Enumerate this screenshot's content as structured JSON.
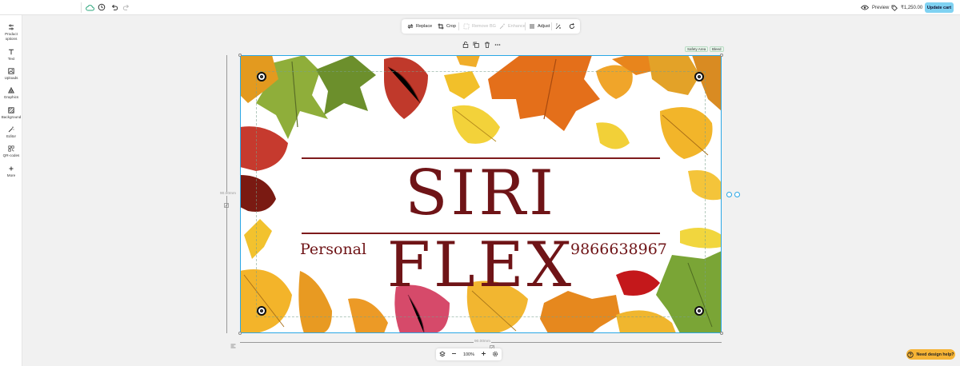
{
  "topbar": {
    "preview_label": "Preview",
    "price": "₹1,250.00",
    "update_label": "Update cart"
  },
  "sidebar": {
    "items": [
      {
        "label": "Product options",
        "icon": "sliders-icon"
      },
      {
        "label": "Text",
        "icon": "text-icon"
      },
      {
        "label": "Uploads",
        "icon": "upload-icon"
      },
      {
        "label": "Graphics",
        "icon": "shapes-icon"
      },
      {
        "label": "Background",
        "icon": "background-icon"
      },
      {
        "label": "Editor",
        "icon": "magic-wand-icon"
      },
      {
        "label": "QR-codes",
        "icon": "qr-code-icon"
      },
      {
        "label": "More",
        "icon": "plus-icon"
      }
    ]
  },
  "toolbar": {
    "replace": "Replace",
    "crop": "Crop",
    "remove_bg": "Remove BG",
    "enhance": "Enhance",
    "adjust": "Adjust"
  },
  "badges": {
    "safety": "Safety Area",
    "bleed": "Bleed"
  },
  "card": {
    "title": "SIRI FLEX",
    "subtitle_left": "Personal",
    "subtitle_right": "9866638967",
    "text_color": "#6f1417"
  },
  "rulers": {
    "vertical_label": "90.00mm",
    "horizontal_label": "90.00mm"
  },
  "zoom": {
    "level": "100%"
  },
  "help": {
    "label": "Need design help?"
  },
  "colors": {
    "accent": "#2aa7e6",
    "update_button": "#7fd2f2",
    "help_button": "#f5b335"
  }
}
